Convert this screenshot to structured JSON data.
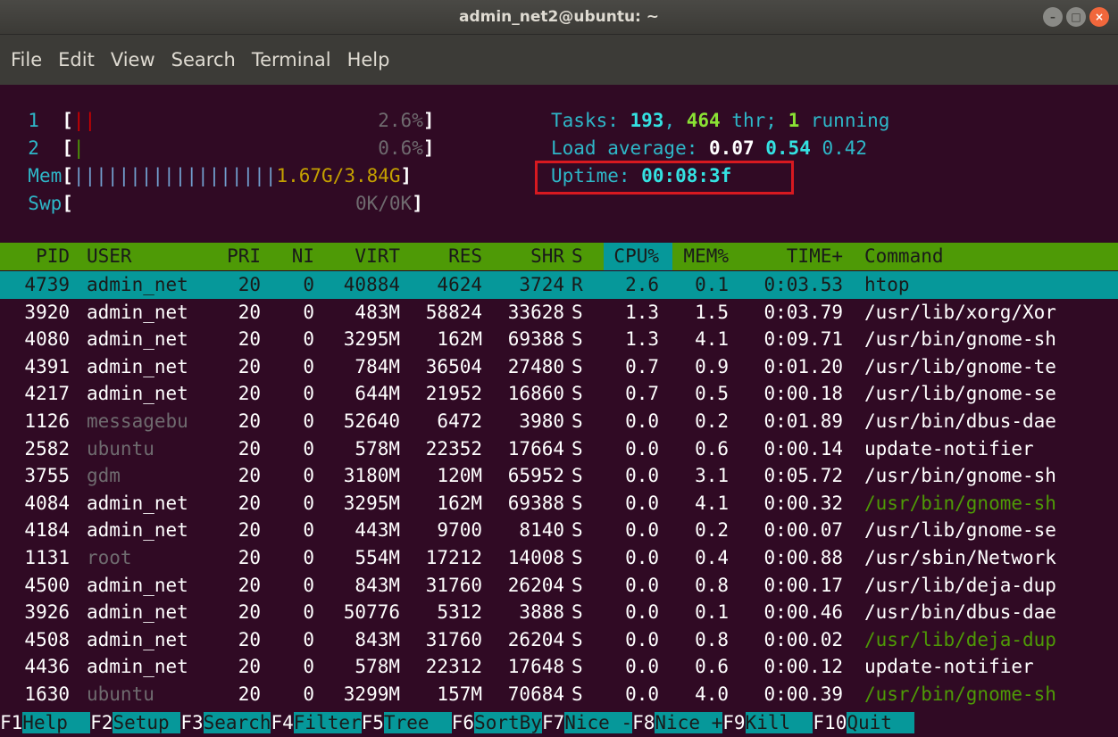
{
  "window": {
    "title": "admin_net2@ubuntu: ~",
    "buttons": [
      "–",
      "□",
      "×"
    ]
  },
  "menubar": [
    "File",
    "Edit",
    "View",
    "Search",
    "Terminal",
    "Help"
  ],
  "meters": {
    "cpu1": {
      "label": "1",
      "bar": "||",
      "value": "2.6%"
    },
    "cpu2": {
      "label": "2",
      "bar": "|",
      "value": "0.6%"
    },
    "mem": {
      "label": "Mem",
      "bar": "||||||||||||||||||",
      "value": "1.67G/3.84G"
    },
    "swp": {
      "label": "Swp",
      "value": "0K/0K"
    }
  },
  "stats": {
    "tasks_label": "Tasks:",
    "tasks": "193",
    "thr": "464",
    "thr_label": "thr;",
    "running": "1",
    "running_label": "running",
    "load_label": "Load average:",
    "load1": "0.07",
    "load5": "0.54",
    "load15": "0.42",
    "uptime_label": "Uptime:",
    "uptime": "00:08:3f"
  },
  "table": {
    "headers": [
      "PID",
      "USER",
      "PRI",
      "NI",
      "VIRT",
      "RES",
      "SHR",
      "S",
      "CPU%",
      "MEM%",
      "TIME+",
      "Command"
    ],
    "rows": [
      {
        "pid": "4739",
        "user": "admin_net",
        "pri": "20",
        "ni": "0",
        "virt": "40884",
        "res": "4624",
        "shr": "3724",
        "s": "R",
        "cpu": "2.6",
        "mem": "0.1",
        "time": "0:03.53",
        "cmd": "htop",
        "selected": true
      },
      {
        "pid": "3920",
        "user": "admin_net",
        "pri": "20",
        "ni": "0",
        "virt": "483M",
        "res": "58824",
        "shr": "33628",
        "s": "S",
        "cpu": "1.3",
        "mem": "1.5",
        "time": "0:03.79",
        "cmd": "/usr/lib/xorg/Xor"
      },
      {
        "pid": "4080",
        "user": "admin_net",
        "pri": "20",
        "ni": "0",
        "virt": "3295M",
        "res": "162M",
        "shr": "69388",
        "s": "S",
        "cpu": "1.3",
        "mem": "4.1",
        "time": "0:09.71",
        "cmd": "/usr/bin/gnome-sh"
      },
      {
        "pid": "4391",
        "user": "admin_net",
        "pri": "20",
        "ni": "0",
        "virt": "784M",
        "res": "36504",
        "shr": "27480",
        "s": "S",
        "cpu": "0.7",
        "mem": "0.9",
        "time": "0:01.20",
        "cmd": "/usr/lib/gnome-te"
      },
      {
        "pid": "4217",
        "user": "admin_net",
        "pri": "20",
        "ni": "0",
        "virt": "644M",
        "res": "21952",
        "shr": "16860",
        "s": "S",
        "cpu": "0.7",
        "mem": "0.5",
        "time": "0:00.18",
        "cmd": "/usr/lib/gnome-se"
      },
      {
        "pid": "1126",
        "user": "messagebu",
        "pri": "20",
        "ni": "0",
        "virt": "52640",
        "res": "6472",
        "shr": "3980",
        "s": "S",
        "cpu": "0.0",
        "mem": "0.2",
        "time": "0:01.89",
        "cmd": "/usr/bin/dbus-dae",
        "dim_user": true
      },
      {
        "pid": "2582",
        "user": "ubuntu",
        "pri": "20",
        "ni": "0",
        "virt": "578M",
        "res": "22352",
        "shr": "17664",
        "s": "S",
        "cpu": "0.0",
        "mem": "0.6",
        "time": "0:00.14",
        "cmd": "update-notifier",
        "dim_user": true
      },
      {
        "pid": "3755",
        "user": "gdm",
        "pri": "20",
        "ni": "0",
        "virt": "3180M",
        "res": "120M",
        "shr": "65952",
        "s": "S",
        "cpu": "0.0",
        "mem": "3.1",
        "time": "0:05.72",
        "cmd": "/usr/bin/gnome-sh",
        "dim_user": true
      },
      {
        "pid": "4084",
        "user": "admin_net",
        "pri": "20",
        "ni": "0",
        "virt": "3295M",
        "res": "162M",
        "shr": "69388",
        "s": "S",
        "cpu": "0.0",
        "mem": "4.1",
        "time": "0:00.32",
        "cmd": "/usr/bin/gnome-sh",
        "green_cmd": true
      },
      {
        "pid": "4184",
        "user": "admin_net",
        "pri": "20",
        "ni": "0",
        "virt": "443M",
        "res": "9700",
        "shr": "8140",
        "s": "S",
        "cpu": "0.0",
        "mem": "0.2",
        "time": "0:00.07",
        "cmd": "/usr/lib/gnome-se"
      },
      {
        "pid": "1131",
        "user": "root",
        "pri": "20",
        "ni": "0",
        "virt": "554M",
        "res": "17212",
        "shr": "14008",
        "s": "S",
        "cpu": "0.0",
        "mem": "0.4",
        "time": "0:00.88",
        "cmd": "/usr/sbin/Network",
        "dim_user": true
      },
      {
        "pid": "4500",
        "user": "admin_net",
        "pri": "20",
        "ni": "0",
        "virt": "843M",
        "res": "31760",
        "shr": "26204",
        "s": "S",
        "cpu": "0.0",
        "mem": "0.8",
        "time": "0:00.17",
        "cmd": "/usr/lib/deja-dup"
      },
      {
        "pid": "3926",
        "user": "admin_net",
        "pri": "20",
        "ni": "0",
        "virt": "50776",
        "res": "5312",
        "shr": "3888",
        "s": "S",
        "cpu": "0.0",
        "mem": "0.1",
        "time": "0:00.46",
        "cmd": "/usr/bin/dbus-dae"
      },
      {
        "pid": "4508",
        "user": "admin_net",
        "pri": "20",
        "ni": "0",
        "virt": "843M",
        "res": "31760",
        "shr": "26204",
        "s": "S",
        "cpu": "0.0",
        "mem": "0.8",
        "time": "0:00.02",
        "cmd": "/usr/lib/deja-dup",
        "green_cmd": true
      },
      {
        "pid": "4436",
        "user": "admin_net",
        "pri": "20",
        "ni": "0",
        "virt": "578M",
        "res": "22312",
        "shr": "17648",
        "s": "S",
        "cpu": "0.0",
        "mem": "0.6",
        "time": "0:00.12",
        "cmd": "update-notifier"
      },
      {
        "pid": "1630",
        "user": "ubuntu",
        "pri": "20",
        "ni": "0",
        "virt": "3299M",
        "res": "157M",
        "shr": "70684",
        "s": "S",
        "cpu": "0.0",
        "mem": "4.0",
        "time": "0:00.39",
        "cmd": "/usr/bin/gnome-sh",
        "dim_user": true,
        "green_cmd": true
      }
    ]
  },
  "fkeys": [
    {
      "key": "F1",
      "label": "Help  "
    },
    {
      "key": "F2",
      "label": "Setup "
    },
    {
      "key": "F3",
      "label": "Search"
    },
    {
      "key": "F4",
      "label": "Filter"
    },
    {
      "key": "F5",
      "label": "Tree  "
    },
    {
      "key": "F6",
      "label": "SortBy"
    },
    {
      "key": "F7",
      "label": "Nice -"
    },
    {
      "key": "F8",
      "label": "Nice +"
    },
    {
      "key": "F9",
      "label": "Kill  "
    },
    {
      "key": "F10",
      "label": "Quit  "
    }
  ]
}
